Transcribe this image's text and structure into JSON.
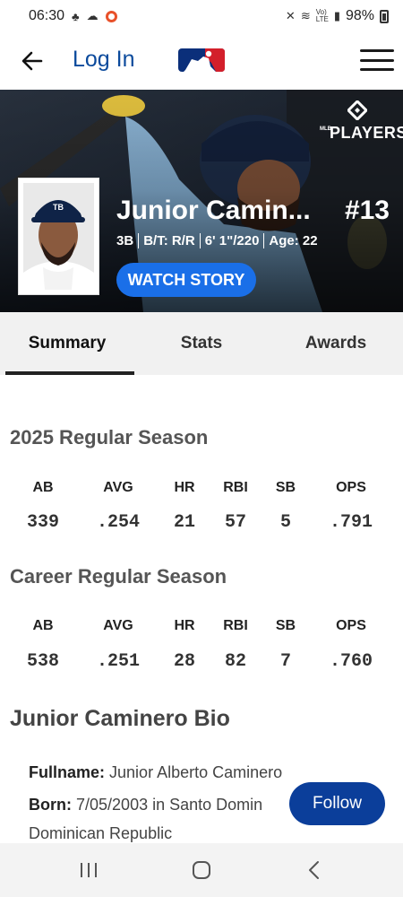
{
  "status_bar": {
    "time": "06:30",
    "battery": "98%",
    "icons": [
      "notification-icon",
      "weather-icon",
      "ring-icon",
      "mute-icon",
      "wifi-icon",
      "volte-icon",
      "signal-icon",
      "battery-icon"
    ]
  },
  "header": {
    "login_label": "Log In",
    "logo": "mlb-logo",
    "back_icon": "back-arrow-icon",
    "menu_icon": "hamburger-menu-icon"
  },
  "hero": {
    "players_logo_small": "MLB",
    "players_logo_big": "PLAYERS",
    "player_name": "Junior Camin...",
    "number": "#13",
    "meta": [
      "3B",
      "B/T: R/R",
      "6' 1\"/220",
      "Age: 22"
    ],
    "watch_label": "WATCH STORY",
    "accent": "#1a6fe8"
  },
  "tabs": [
    {
      "label": "Summary",
      "active": true
    },
    {
      "label": "Stats",
      "active": false
    },
    {
      "label": "Awards",
      "active": false
    }
  ],
  "season": {
    "title": "2025 Regular Season",
    "headers": [
      "AB",
      "AVG",
      "HR",
      "RBI",
      "SB",
      "OPS"
    ],
    "values": [
      "339",
      ".254",
      "21",
      "57",
      "5",
      ".791"
    ]
  },
  "career": {
    "title": "Career Regular Season",
    "headers": [
      "AB",
      "AVG",
      "HR",
      "RBI",
      "SB",
      "OPS"
    ],
    "values": [
      "538",
      ".251",
      "28",
      "82",
      "7",
      ".760"
    ]
  },
  "bio": {
    "title": "Junior Caminero Bio",
    "fullname_label": "Fullname:",
    "fullname_value": "Junior Alberto Caminero",
    "born_label": "Born:",
    "born_value": "7/05/2003 in Santo Domin",
    "born_value_line2": "Dominican Republic"
  },
  "follow_label": "Follow",
  "nav": [
    "recent-apps-icon",
    "home-icon",
    "back-icon"
  ]
}
